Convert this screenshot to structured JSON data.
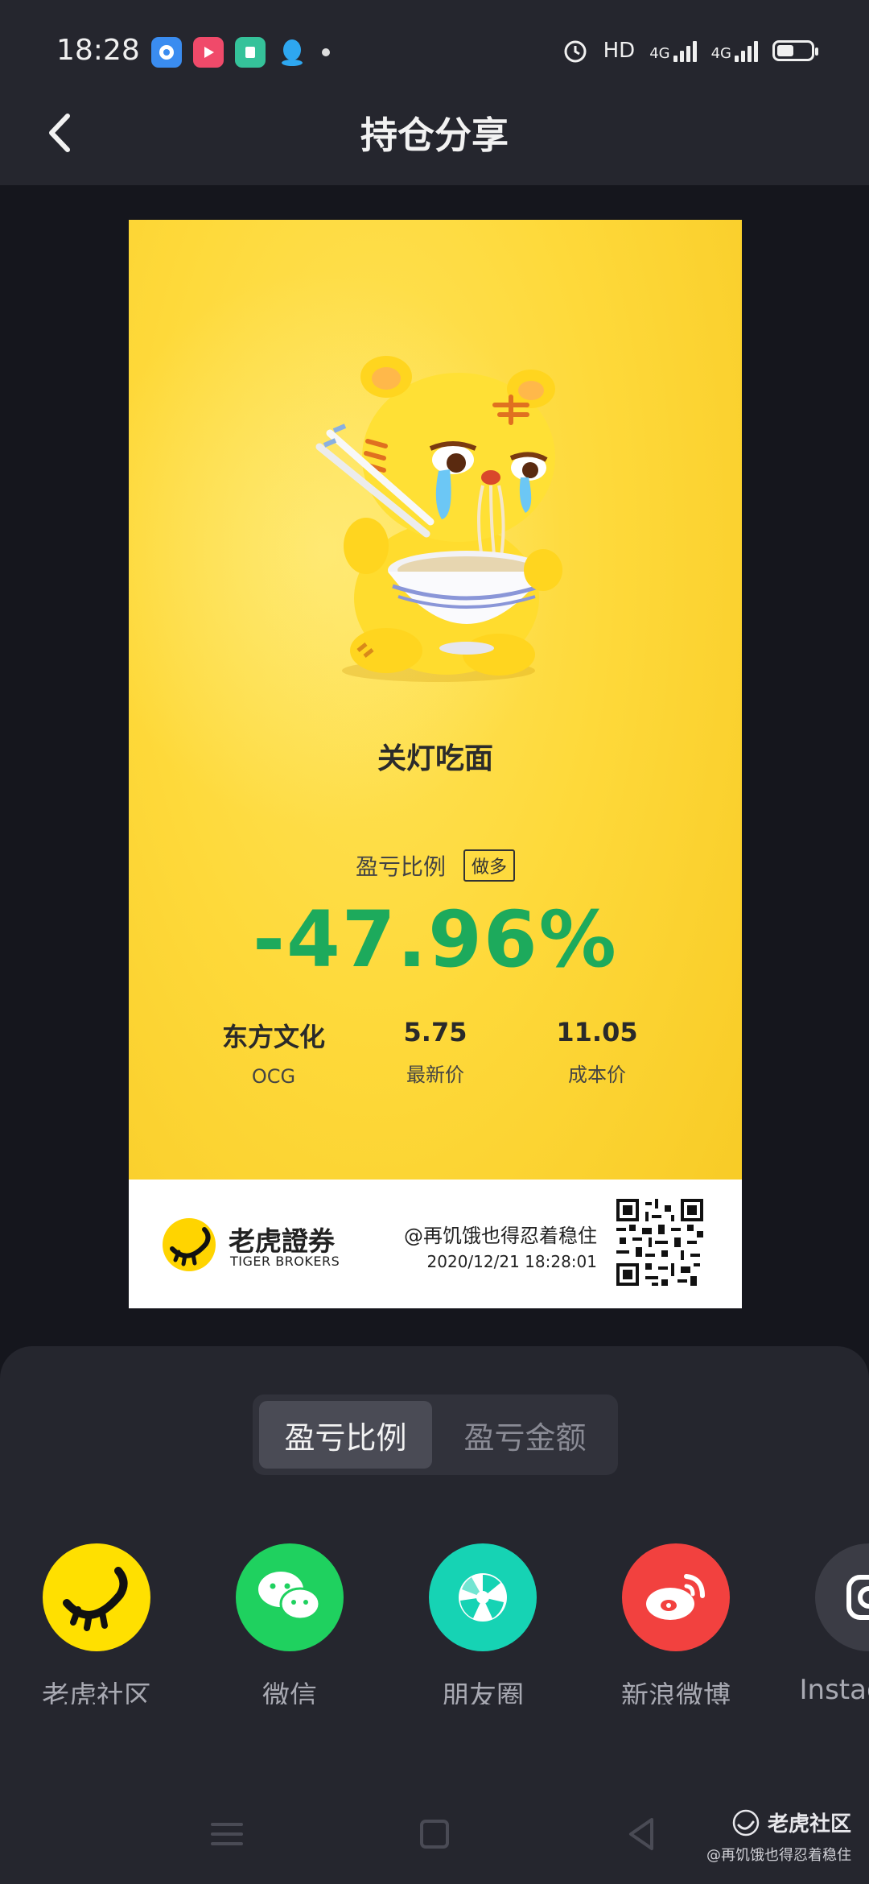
{
  "status_bar": {
    "time": "18:28",
    "network_hd": "HD",
    "net_type_1": "4G",
    "net_type_2": "4G"
  },
  "header": {
    "title": "持仓分享"
  },
  "card": {
    "nickname": "关灯吃面",
    "ratio_label": "盈亏比例",
    "direction_tag": "做多",
    "ratio_value": "-47.96%",
    "ratio_color": "#1daa5c",
    "stock_name": "东方文化",
    "stock_ticker": "OCG",
    "latest_price": "5.75",
    "latest_price_label": "最新价",
    "cost_price": "11.05",
    "cost_price_label": "成本价",
    "brand_cn": "老虎證券",
    "brand_en": "TIGER BROKERS",
    "share_user": "@再饥饿也得忍着稳住",
    "share_time": "2020/12/21 18:28:01"
  },
  "toggle": {
    "options": [
      "盈亏比例",
      "盈亏金额"
    ],
    "selected": "盈亏比例"
  },
  "share_targets": [
    {
      "label": "老虎社区",
      "icon": "tiger-community-icon",
      "color": "#ffe000"
    },
    {
      "label": "微信",
      "icon": "wechat-icon",
      "color": "#1fd15f"
    },
    {
      "label": "朋友圈",
      "icon": "moments-icon",
      "color": "#16d3b4"
    },
    {
      "label": "新浪微博",
      "icon": "weibo-icon",
      "color": "#f2413f"
    },
    {
      "label": "Instagram",
      "icon": "instagram-icon",
      "color": "#3b3c45"
    }
  ],
  "watermark": {
    "line1": "老虎社区",
    "line2": "@再饥饿也得忍着稳住"
  }
}
